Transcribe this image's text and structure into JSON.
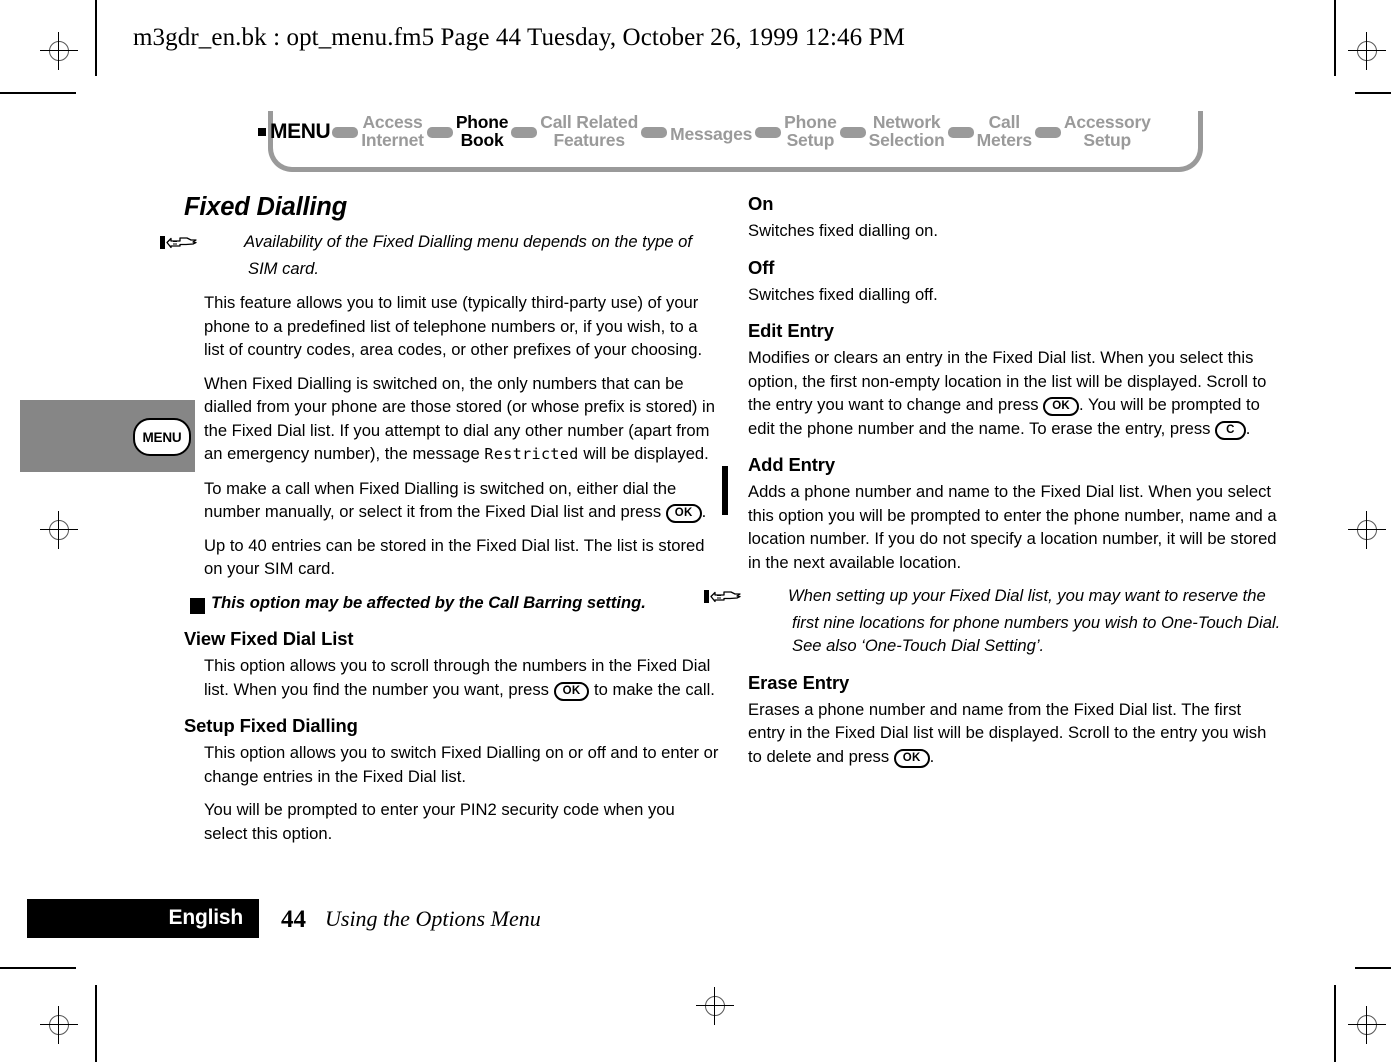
{
  "header": {
    "running_head": "m3gdr_en.bk : opt_menu.fm5  Page 44  Tuesday, October 26, 1999  12:46 PM"
  },
  "nav": {
    "menu_label": "MENU",
    "items": [
      {
        "line1": "Access",
        "line2": "Internet",
        "active": false
      },
      {
        "line1": "Phone",
        "line2": "Book",
        "active": true
      },
      {
        "line1": "Call Related",
        "line2": "Features",
        "active": false
      },
      {
        "line1": "Messages",
        "line2": "",
        "active": false
      },
      {
        "line1": "Phone",
        "line2": "Setup",
        "active": false
      },
      {
        "line1": "Network",
        "line2": "Selection",
        "active": false
      },
      {
        "line1": "Call",
        "line2": "Meters",
        "active": false
      },
      {
        "line1": "Accessory",
        "line2": "Setup",
        "active": false
      }
    ]
  },
  "margin_tab": {
    "key_label": "MENU"
  },
  "left_column": {
    "title": "Fixed Dialling",
    "note1": "Availability of the Fixed Dialling menu depends on the type of SIM card.",
    "para1": "This feature allows you to limit use (typically third-party use) of your phone to a predefined list of telephone numbers or, if you wish, to a list of country codes, area codes, or other prefixes of your choosing.",
    "para2_a": "When Fixed Dialling is switched on, the only numbers that can be dialled from your phone are those stored (or whose prefix is stored) in the Fixed Dial list. If you attempt to dial any other number (apart from an emergency number), the message ",
    "para2_lcd": "Restricted",
    "para2_b": " will be displayed.",
    "para3_a": "To make a call when Fixed Dialling is switched on, either dial the number manually, or select it from the Fixed Dial list and press ",
    "para3_key": "OK",
    "para3_b": ".",
    "para4": "Up to 40 entries can be stored in the Fixed Dial list. The list is stored on your SIM card.",
    "warning": "This option may be affected by the Call Barring setting.",
    "warning_icon": "!",
    "head_view": "View Fixed Dial List",
    "view_a": "This option allows you to scroll through the numbers in the Fixed Dial list. When you find the number you want, press ",
    "view_key": "OK",
    "view_b": " to make the call.",
    "head_setup": "Setup Fixed Dialling",
    "setup_para1": "This option allows you to switch Fixed Dialling on or off and to enter or change entries in the Fixed Dial list.",
    "setup_para2": "You will be prompted to enter your PIN2 security code when you select this option."
  },
  "right_column": {
    "head_on": "On",
    "on_text": "Switches fixed dialling on.",
    "head_off": "Off",
    "off_text": "Switches fixed dialling off.",
    "head_edit": "Edit Entry",
    "edit_a": "Modifies or clears an entry in the Fixed Dial list. When you select this option, the first non-empty location in the list will be displayed. Scroll to the entry you want to change and press ",
    "edit_key_ok": "OK",
    "edit_b": ". You will be prompted to edit the phone number and the name. To erase the entry, press ",
    "edit_key_c": "C",
    "edit_c": ".",
    "head_add": "Add Entry",
    "add_text": "Adds a phone number and name to the Fixed Dial list. When you select this option you will be prompted to enter the phone number, name and a location number. If you do not specify a location number, it will be stored in the next available location.",
    "note2": "When setting up your Fixed Dial list, you may want to reserve the first nine locations for phone numbers you wish to One-Touch Dial. See also ‘One-Touch Dial Setting’.",
    "head_erase": "Erase Entry",
    "erase_a": "Erases a phone number and name from the Fixed Dial list. The first entry in the Fixed Dial list will be displayed. Scroll to the entry you wish to delete and press ",
    "erase_key": "OK",
    "erase_b": "."
  },
  "footer": {
    "language": "English",
    "page_number": "44",
    "section_title": "Using the Options Menu"
  },
  "colors": {
    "nav_inactive": "#9a9a9a",
    "nav_active": "#000000",
    "margin_tab": "#868686",
    "footer_bar": "#000000"
  }
}
